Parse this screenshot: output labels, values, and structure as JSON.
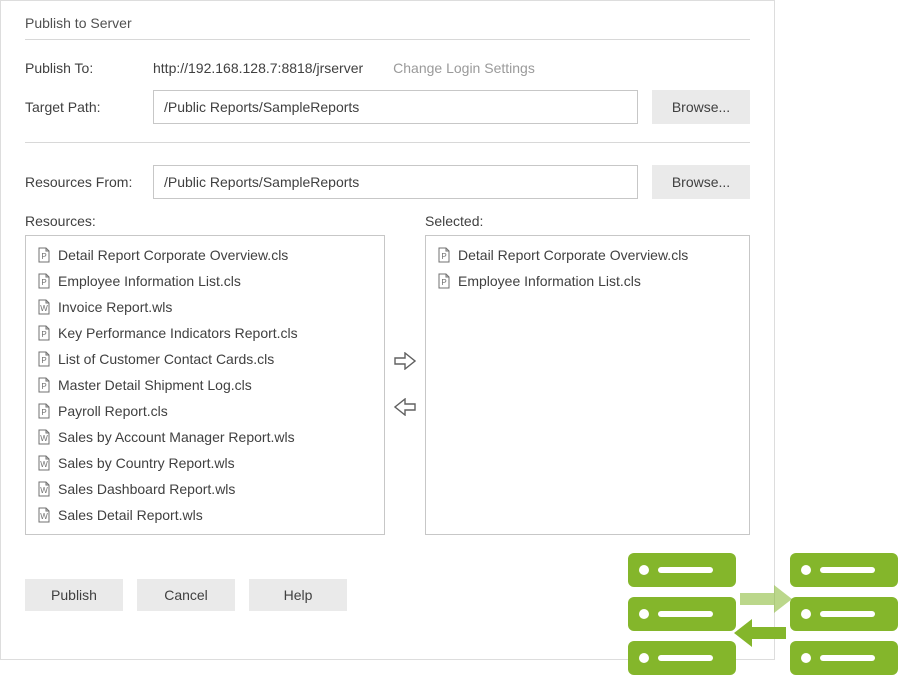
{
  "title": "Publish to Server",
  "publish_to_label": "Publish To:",
  "publish_to_url": "http://192.168.128.7:8818/jrserver",
  "change_login_label": "Change Login Settings",
  "target_path_label": "Target Path:",
  "target_path_value": "/Public Reports/SampleReports",
  "browse_label": "Browse...",
  "resources_from_label": "Resources From:",
  "resources_from_value": "/Public Reports/SampleReports",
  "resources_label": "Resources:",
  "selected_label": "Selected:",
  "resources": [
    {
      "icon": "P",
      "name": "Detail Report Corporate Overview.cls"
    },
    {
      "icon": "P",
      "name": "Employee Information List.cls"
    },
    {
      "icon": "W",
      "name": "Invoice Report.wls"
    },
    {
      "icon": "P",
      "name": "Key Performance Indicators Report.cls"
    },
    {
      "icon": "P",
      "name": "List of Customer Contact Cards.cls"
    },
    {
      "icon": "P",
      "name": "Master Detail Shipment Log.cls"
    },
    {
      "icon": "P",
      "name": "Payroll Report.cls"
    },
    {
      "icon": "W",
      "name": "Sales by Account Manager Report.wls"
    },
    {
      "icon": "W",
      "name": "Sales by Country Report.wls"
    },
    {
      "icon": "W",
      "name": "Sales Dashboard Report.wls"
    },
    {
      "icon": "W",
      "name": "Sales Detail Report.wls"
    }
  ],
  "selected": [
    {
      "icon": "P",
      "name": "Detail Report Corporate Overview.cls"
    },
    {
      "icon": "P",
      "name": "Employee Information List.cls"
    }
  ],
  "buttons": {
    "publish": "Publish",
    "cancel": "Cancel",
    "help": "Help"
  },
  "colors": {
    "accent_green": "#84b62b"
  }
}
